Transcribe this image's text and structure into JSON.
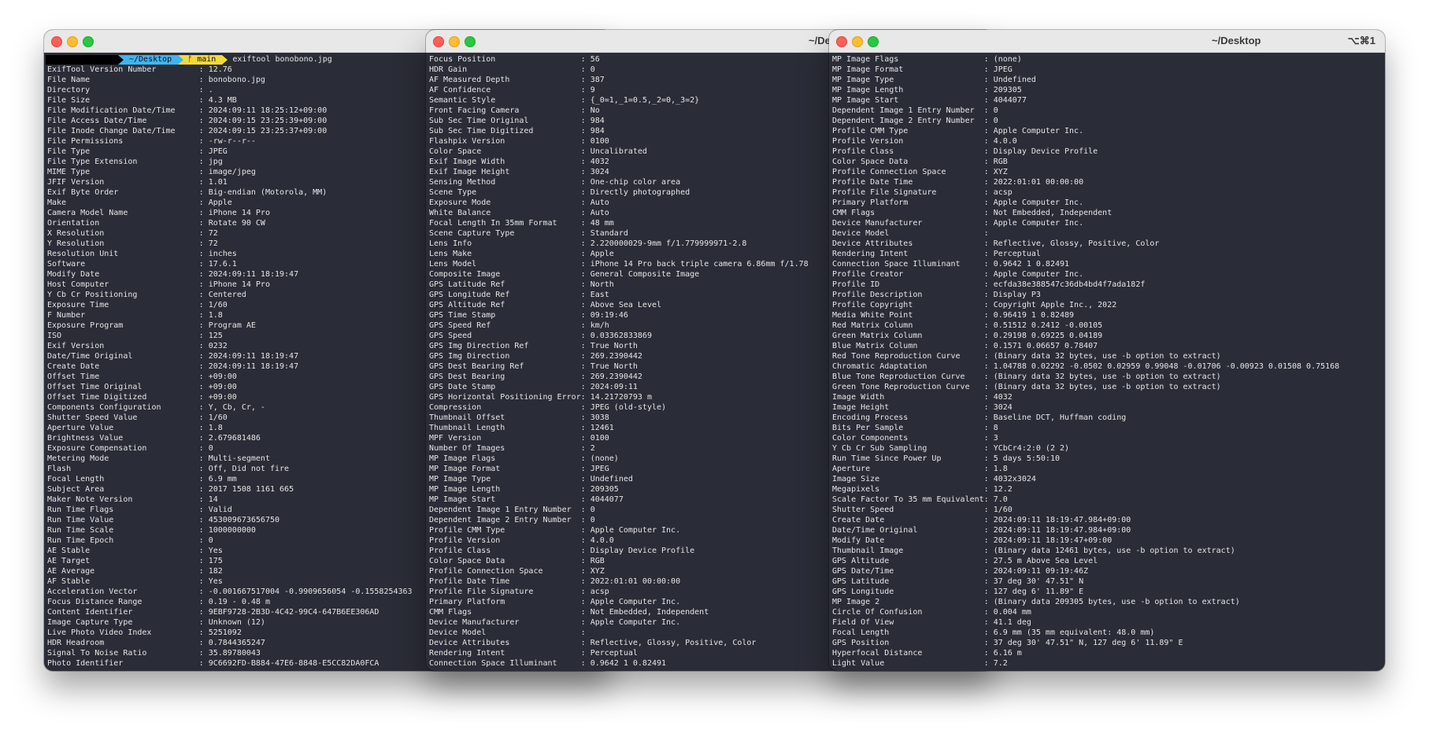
{
  "colors": {
    "terminal_bg": "#2a2c37",
    "prompt_dir_bg": "#3fb5f0",
    "prompt_branch_bg": "#f4d93c",
    "text": "#e6e6e6"
  },
  "windows": [
    {
      "title": "",
      "shortcut": "",
      "prompt": {
        "dir": "~/Desktop",
        "branch": "main",
        "command": "exiftool bonobono.jpg"
      },
      "lines": [
        "ExifTool Version Number         : 12.76",
        "File Name                       : bonobono.jpg",
        "Directory                       : .",
        "File Size                       : 4.3 MB",
        "File Modification Date/Time     : 2024:09:11 18:25:12+09:00",
        "File Access Date/Time           : 2024:09:15 23:25:39+09:00",
        "File Inode Change Date/Time     : 2024:09:15 23:25:37+09:00",
        "File Permissions                : -rw-r--r--",
        "File Type                       : JPEG",
        "File Type Extension             : jpg",
        "MIME Type                       : image/jpeg",
        "JFIF Version                    : 1.01",
        "Exif Byte Order                 : Big-endian (Motorola, MM)",
        "Make                            : Apple",
        "Camera Model Name               : iPhone 14 Pro",
        "Orientation                     : Rotate 90 CW",
        "X Resolution                    : 72",
        "Y Resolution                    : 72",
        "Resolution Unit                 : inches",
        "Software                        : 17.6.1",
        "Modify Date                     : 2024:09:11 18:19:47",
        "Host Computer                   : iPhone 14 Pro",
        "Y Cb Cr Positioning             : Centered",
        "Exposure Time                   : 1/60",
        "F Number                        : 1.8",
        "Exposure Program                : Program AE",
        "ISO                             : 125",
        "Exif Version                    : 0232",
        "Date/Time Original              : 2024:09:11 18:19:47",
        "Create Date                     : 2024:09:11 18:19:47",
        "Offset Time                     : +09:00",
        "Offset Time Original            : +09:00",
        "Offset Time Digitized           : +09:00",
        "Components Configuration        : Y, Cb, Cr, -",
        "Shutter Speed Value             : 1/60",
        "Aperture Value                  : 1.8",
        "Brightness Value                : 2.679681486",
        "Exposure Compensation           : 0",
        "Metering Mode                   : Multi-segment",
        "Flash                           : Off, Did not fire",
        "Focal Length                    : 6.9 mm",
        "Subject Area                    : 2017 1508 1161 665",
        "Maker Note Version              : 14",
        "Run Time Flags                  : Valid",
        "Run Time Value                  : 453009673656750",
        "Run Time Scale                  : 1000000000",
        "Run Time Epoch                  : 0",
        "AE Stable                       : Yes",
        "AE Target                       : 175",
        "AE Average                      : 182",
        "AF Stable                       : Yes",
        "Acceleration Vector             : -0.001667517004 -0.9909656054 -0.1558254363",
        "Focus Distance Range            : 0.19 - 0.48 m",
        "Content Identifier              : 9EBF9728-2B3D-4C42-99C4-647B6EE306AD",
        "Image Capture Type              : Unknown (12)",
        "Live Photo Video Index          : 5251092",
        "HDR Headroom                    : 0.7844365247",
        "Signal To Noise Ratio           : 35.89780043",
        "Photo Identifier                : 9C6692FD-B884-47E6-8848-E5CC82DA0FCA"
      ]
    },
    {
      "title": "~/De",
      "shortcut": "",
      "lines": [
        "Focus Position                  : 56",
        "HDR Gain                        : 0",
        "AF Measured Depth               : 387",
        "AF Confidence                   : 9",
        "Semantic Style                  : {_0=1,_1=0.5,_2=0,_3=2}",
        "Front Facing Camera             : No",
        "Sub Sec Time Original           : 984",
        "Sub Sec Time Digitized          : 984",
        "Flashpix Version                : 0100",
        "Color Space                     : Uncalibrated",
        "Exif Image Width                : 4032",
        "Exif Image Height               : 3024",
        "Sensing Method                  : One-chip color area",
        "Scene Type                      : Directly photographed",
        "Exposure Mode                   : Auto",
        "White Balance                   : Auto",
        "Focal Length In 35mm Format     : 48 mm",
        "Scene Capture Type              : Standard",
        "Lens Info                       : 2.220000029-9mm f/1.779999971-2.8",
        "Lens Make                       : Apple",
        "Lens Model                      : iPhone 14 Pro back triple camera 6.86mm f/1.78",
        "Composite Image                 : General Composite Image",
        "GPS Latitude Ref                : North",
        "GPS Longitude Ref               : East",
        "GPS Altitude Ref                : Above Sea Level",
        "GPS Time Stamp                  : 09:19:46",
        "GPS Speed Ref                   : km/h",
        "GPS Speed                       : 0.03362833869",
        "GPS Img Direction Ref           : True North",
        "GPS Img Direction               : 269.2390442",
        "GPS Dest Bearing Ref            : True North",
        "GPS Dest Bearing                : 269.2390442",
        "GPS Date Stamp                  : 2024:09:11",
        "GPS Horizontal Positioning Error: 14.21720793 m",
        "Compression                     : JPEG (old-style)",
        "Thumbnail Offset                : 3038",
        "Thumbnail Length                : 12461",
        "MPF Version                     : 0100",
        "Number Of Images                : 2",
        "MP Image Flags                  : (none)",
        "MP Image Format                 : JPEG",
        "MP Image Type                   : Undefined",
        "MP Image Length                 : 209305",
        "MP Image Start                  : 4044077",
        "Dependent Image 1 Entry Number  : 0",
        "Dependent Image 2 Entry Number  : 0",
        "Profile CMM Type                : Apple Computer Inc.",
        "Profile Version                 : 4.0.0",
        "Profile Class                   : Display Device Profile",
        "Color Space Data                : RGB",
        "Profile Connection Space        : XYZ",
        "Profile Date Time               : 2022:01:01 00:00:00",
        "Profile File Signature          : acsp",
        "Primary Platform                : Apple Computer Inc.",
        "CMM Flags                       : Not Embedded, Independent",
        "Device Manufacturer             : Apple Computer Inc.",
        "Device Model                    :",
        "Device Attributes               : Reflective, Glossy, Positive, Color",
        "Rendering Intent                : Perceptual",
        "Connection Space Illuminant     : 0.9642 1 0.82491"
      ]
    },
    {
      "title": "~/Desktop",
      "shortcut": "⌥⌘1",
      "lines": [
        "MP Image Flags                  : (none)",
        "MP Image Format                 : JPEG",
        "MP Image Type                   : Undefined",
        "MP Image Length                 : 209305",
        "MP Image Start                  : 4044077",
        "Dependent Image 1 Entry Number  : 0",
        "Dependent Image 2 Entry Number  : 0",
        "Profile CMM Type                : Apple Computer Inc.",
        "Profile Version                 : 4.0.0",
        "Profile Class                   : Display Device Profile",
        "Color Space Data                : RGB",
        "Profile Connection Space        : XYZ",
        "Profile Date Time               : 2022:01:01 00:00:00",
        "Profile File Signature          : acsp",
        "Primary Platform                : Apple Computer Inc.",
        "CMM Flags                       : Not Embedded, Independent",
        "Device Manufacturer             : Apple Computer Inc.",
        "Device Model                    :",
        "Device Attributes               : Reflective, Glossy, Positive, Color",
        "Rendering Intent                : Perceptual",
        "Connection Space Illuminant     : 0.9642 1 0.82491",
        "Profile Creator                 : Apple Computer Inc.",
        "Profile ID                      : ecfda38e388547c36db4bd4f7ada182f",
        "Profile Description             : Display P3",
        "Profile Copyright               : Copyright Apple Inc., 2022",
        "Media White Point               : 0.96419 1 0.82489",
        "Red Matrix Column               : 0.51512 0.2412 -0.00105",
        "Green Matrix Column             : 0.29198 0.69225 0.04189",
        "Blue Matrix Column              : 0.1571 0.06657 0.78407",
        "Red Tone Reproduction Curve     : (Binary data 32 bytes, use -b option to extract)",
        "Chromatic Adaptation            : 1.04788 0.02292 -0.0502 0.02959 0.99048 -0.01706 -0.00923 0.01508 0.75168",
        "Blue Tone Reproduction Curve    : (Binary data 32 bytes, use -b option to extract)",
        "Green Tone Reproduction Curve   : (Binary data 32 bytes, use -b option to extract)",
        "Image Width                     : 4032",
        "Image Height                    : 3024",
        "Encoding Process                : Baseline DCT, Huffman coding",
        "Bits Per Sample                 : 8",
        "Color Components                : 3",
        "Y Cb Cr Sub Sampling            : YCbCr4:2:0 (2 2)",
        "Run Time Since Power Up         : 5 days 5:50:10",
        "Aperture                        : 1.8",
        "Image Size                      : 4032x3024",
        "Megapixels                      : 12.2",
        "Scale Factor To 35 mm Equivalent: 7.0",
        "Shutter Speed                   : 1/60",
        "Create Date                     : 2024:09:11 18:19:47.984+09:00",
        "Date/Time Original              : 2024:09:11 18:19:47.984+09:00",
        "Modify Date                     : 2024:09:11 18:19:47+09:00",
        "Thumbnail Image                 : (Binary data 12461 bytes, use -b option to extract)",
        "GPS Altitude                    : 27.5 m Above Sea Level",
        "GPS Date/Time                   : 2024:09:11 09:19:46Z",
        "GPS Latitude                    : 37 deg 30' 47.51\" N",
        "GPS Longitude                   : 127 deg 6' 11.89\" E",
        "MP Image 2                      : (Binary data 209305 bytes, use -b option to extract)",
        "Circle Of Confusion             : 0.004 mm",
        "Field Of View                   : 41.1 deg",
        "Focal Length                    : 6.9 mm (35 mm equivalent: 48.0 mm)",
        "GPS Position                    : 37 deg 30' 47.51\" N, 127 deg 6' 11.89\" E",
        "Hyperfocal Distance             : 6.16 m",
        "Light Value                     : 7.2"
      ]
    }
  ]
}
